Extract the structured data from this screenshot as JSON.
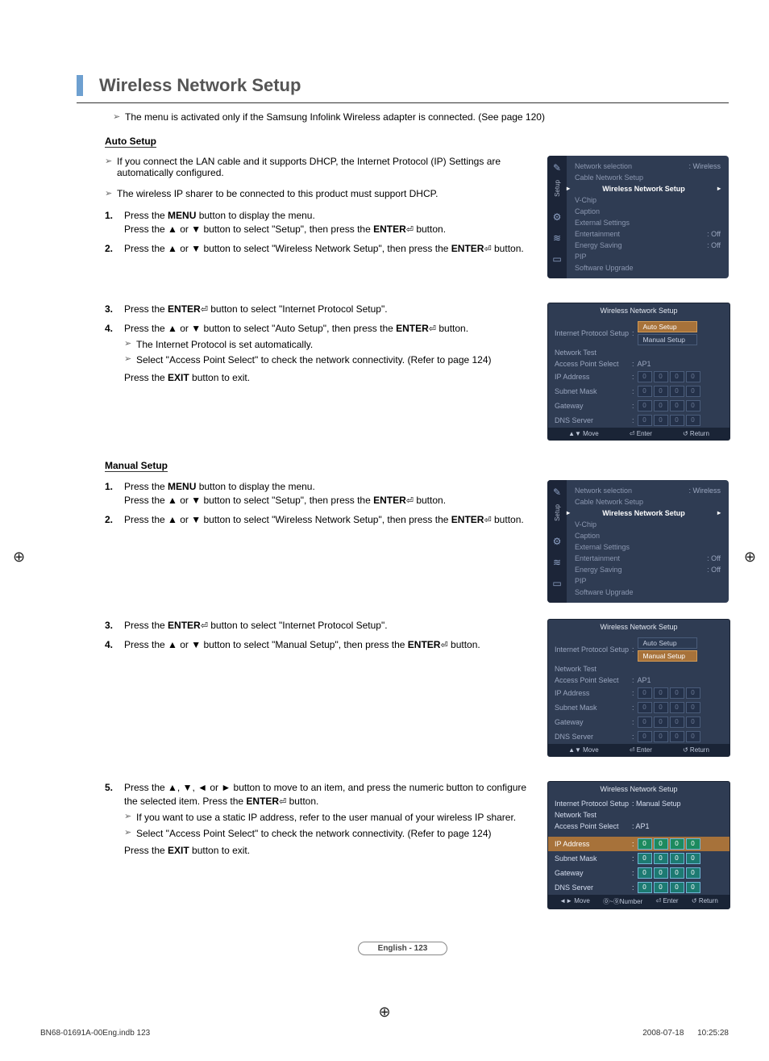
{
  "page": {
    "title": "Wireless Network Setup",
    "intro_note": "The menu is activated only if the Samsung Infolink Wireless adapter is connected. (See page 120)",
    "footer_label": "English - 123",
    "doc_footer_left": "BN68-01691A-00Eng.indb   123",
    "doc_footer_right": "2008-07-18      10:25:28"
  },
  "auto": {
    "heading": "Auto Setup",
    "notes": [
      "If you connect the LAN cable and it supports DHCP, the Internet Protocol (IP) Settings are automatically configured.",
      "The wireless IP sharer to be connected to this product must support DHCP."
    ],
    "stepsA": [
      {
        "n": "1.",
        "t1": "Press the ",
        "b1": "MENU",
        "t2": " button to display the menu.",
        "line2_a": "Press the ▲ or ▼ button to select \"Setup\", then press the ",
        "b2": "ENTER",
        "line2_b": " ",
        "tail": " button."
      },
      {
        "n": "2.",
        "t1": "Press the ▲ or ▼ button to select \"Wireless Network Setup\", then press the ",
        "b1": "ENTER",
        "t2": " ",
        "tail": " button."
      }
    ],
    "stepsB": [
      {
        "n": "3.",
        "t1": "Press the ",
        "b1": "ENTER",
        "t2": " ",
        "tail": " button to select \"Internet Protocol Setup\"."
      },
      {
        "n": "4.",
        "t1": "Press the ▲ or ▼ button to select \"Auto Setup\", then press the ",
        "b1": "ENTER",
        "t2": " ",
        "tail": " button.",
        "subs": [
          "The Internet Protocol is set automatically.",
          "Select \"Access Point Select\" to check the network connectivity. (Refer to page 124)"
        ],
        "post": "Press the ",
        "postb": "EXIT",
        "post2": " button to exit."
      }
    ]
  },
  "manual": {
    "heading": "Manual Setup",
    "stepsA": [
      {
        "n": "1.",
        "t1": "Press the ",
        "b1": "MENU",
        "t2": " button to display the menu.",
        "line2_a": "Press the ▲ or ▼ button to select \"Setup\", then press the ",
        "b2": "ENTER",
        "line2_b": " ",
        "tail": " button."
      },
      {
        "n": "2.",
        "t1": "Press the ▲ or ▼ button to select \"Wireless Network Setup\", then press the ",
        "b1": "ENTER",
        "t2": " ",
        "tail": " button."
      }
    ],
    "stepsB": [
      {
        "n": "3.",
        "t1": "Press the ",
        "b1": "ENTER",
        "t2": " ",
        "tail": " button to select \"Internet Protocol Setup\"."
      },
      {
        "n": "4.",
        "t1": "Press the ▲ or ▼ button to select \"Manual Setup\", then press the ",
        "b1": "ENTER",
        "t2": " ",
        "tail": " button."
      }
    ],
    "stepsC": [
      {
        "n": "5.",
        "t1": "Press the ▲, ▼, ◄ or ► button to move to an item, and press the numeric button to configure the selected item. Press the ",
        "b1": "ENTER",
        "t2": " ",
        "tail": " button.",
        "subs": [
          "If you want to use a static IP address, refer to the user manual of your wireless IP sharer.",
          "Select \"Access Point Select\" to check the network connectivity. (Refer to page 124)"
        ],
        "post": "Press the ",
        "postb": "EXIT",
        "post2": " button to exit."
      }
    ]
  },
  "osd": {
    "side_label": "Setup",
    "rows": [
      {
        "label": "Network selection",
        "value": ": Wireless"
      },
      {
        "label": "Cable Network Setup",
        "value": ""
      },
      {
        "label": "Wireless Network Setup",
        "value": "",
        "active": true
      },
      {
        "label": "V-Chip",
        "value": ""
      },
      {
        "label": "Caption",
        "value": ""
      },
      {
        "label": "External Settings",
        "value": ""
      },
      {
        "label": "Entertainment",
        "value": ": Off"
      },
      {
        "label": "Energy Saving",
        "value": ": Off"
      },
      {
        "label": "PIP",
        "value": ""
      },
      {
        "label": "Software Upgrade",
        "value": ""
      }
    ]
  },
  "wns": {
    "title": "Wireless Network Setup",
    "rows": [
      {
        "label": "Internet Protocol Setup",
        "colon": ":"
      },
      {
        "label": "Network Test"
      },
      {
        "label": "Access Point Select",
        "colon": ": ",
        "value": "AP1"
      },
      {
        "label": "IP Address",
        "quad": [
          "0",
          "0",
          "0",
          "0"
        ]
      },
      {
        "label": "Subnet Mask",
        "quad": [
          "0",
          "0",
          "0",
          "0"
        ]
      },
      {
        "label": "Gateway",
        "quad": [
          "0",
          "0",
          "0",
          "0"
        ]
      },
      {
        "label": "DNS Server",
        "quad": [
          "0",
          "0",
          "0",
          "0"
        ]
      }
    ],
    "opts": {
      "auto": "Auto Setup",
      "manual": "Manual Setup"
    },
    "footer1": {
      "a": "▲▼ Move",
      "b": "⏎ Enter",
      "c": "↺ Return"
    },
    "footer2": {
      "a": "◄► Move",
      "b": "⓪~⑨Number",
      "c": "⏎ Enter",
      "d": "↺ Return"
    },
    "active": {
      "ips": "Internet Protocol Setup",
      "ips_val": ": Manual Setup",
      "nt": "Network Test",
      "aps": "Access Point Select",
      "aps_val": ": AP1",
      "ip": "IP Address",
      "sn": "Subnet Mask",
      "gw": "Gateway",
      "dns": "DNS Server"
    }
  }
}
